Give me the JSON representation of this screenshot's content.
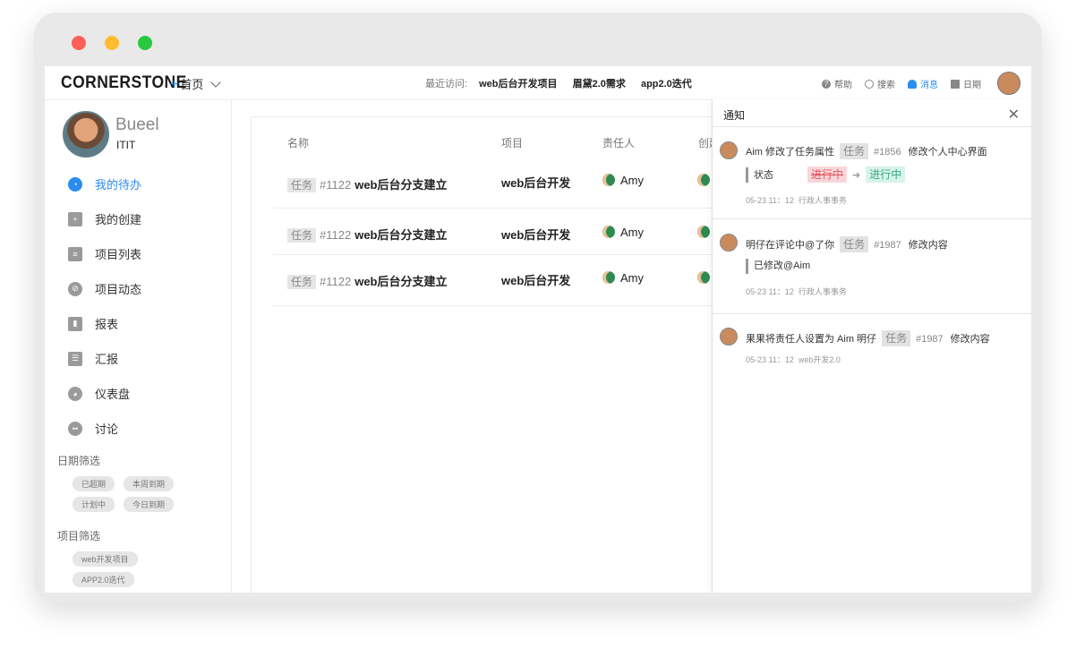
{
  "topnav": {
    "logo": "CORNERSTONE",
    "home_label": "首页",
    "recent_label": "最近访问:",
    "recent_items": [
      "web后台开发项目",
      "眉黛2.0需求",
      "app2.0迭代"
    ],
    "tools": {
      "help": "帮助",
      "search": "搜索",
      "messages": "消息",
      "calendar": "日期"
    }
  },
  "user": {
    "name": "Bueel",
    "team": "ITIT"
  },
  "sidebar": {
    "items": [
      {
        "label": "我的待办",
        "icon": "clock-icon"
      },
      {
        "label": "我的创建",
        "icon": "create-icon"
      },
      {
        "label": "项目列表",
        "icon": "list-icon"
      },
      {
        "label": "项目动态",
        "icon": "compass-icon"
      },
      {
        "label": "报表",
        "icon": "bar-chart-icon"
      },
      {
        "label": "汇报",
        "icon": "report-icon"
      },
      {
        "label": "仪表盘",
        "icon": "pie-icon"
      },
      {
        "label": "讨论",
        "icon": "chat-icon"
      }
    ],
    "date_filter_title": "日期筛选",
    "date_tags": [
      "已超期",
      "本周到期",
      "计划中",
      "今日到期"
    ],
    "project_filter_title": "项目筛选",
    "project_tags": [
      "web开发项目",
      "APP2.0迭代"
    ]
  },
  "table": {
    "headers": {
      "name": "名称",
      "project": "项目",
      "owner": "责任人",
      "creator": "创建"
    },
    "rows": [
      {
        "type": "任务",
        "id": "#1122",
        "title": "web后台分支建立",
        "project": "web后台开发",
        "owner": "Amy"
      },
      {
        "type": "任务",
        "id": "#1122",
        "title": "web后台分支建立",
        "project": "web后台开发",
        "owner": "Amy"
      },
      {
        "type": "任务",
        "id": "#1122",
        "title": "web后台分支建立",
        "project": "web后台开发",
        "owner": "Amy"
      }
    ]
  },
  "notifications": {
    "title": "通知",
    "items": [
      {
        "text": "Aim 修改了任务属性",
        "tag": "任务",
        "id": "#1856",
        "subject": "修改个人中心界面",
        "quote_label": "状态",
        "old": "进行中",
        "new": "进行中",
        "time": "05-23 11：12",
        "source": "行政人事事务"
      },
      {
        "text": "明仔在评论中@了你",
        "tag": "任务",
        "id": "#1987",
        "subject": "修改内容",
        "quote": "已修改@Aim",
        "time": "05-23 11：12",
        "source": "行政人事事务"
      },
      {
        "text": "果果将责任人设置为 Aim 明仔",
        "tag": "任务",
        "id": "#1987",
        "subject": "修改内容",
        "time": "05-23 11：12",
        "source": "web开发2.0"
      }
    ]
  }
}
